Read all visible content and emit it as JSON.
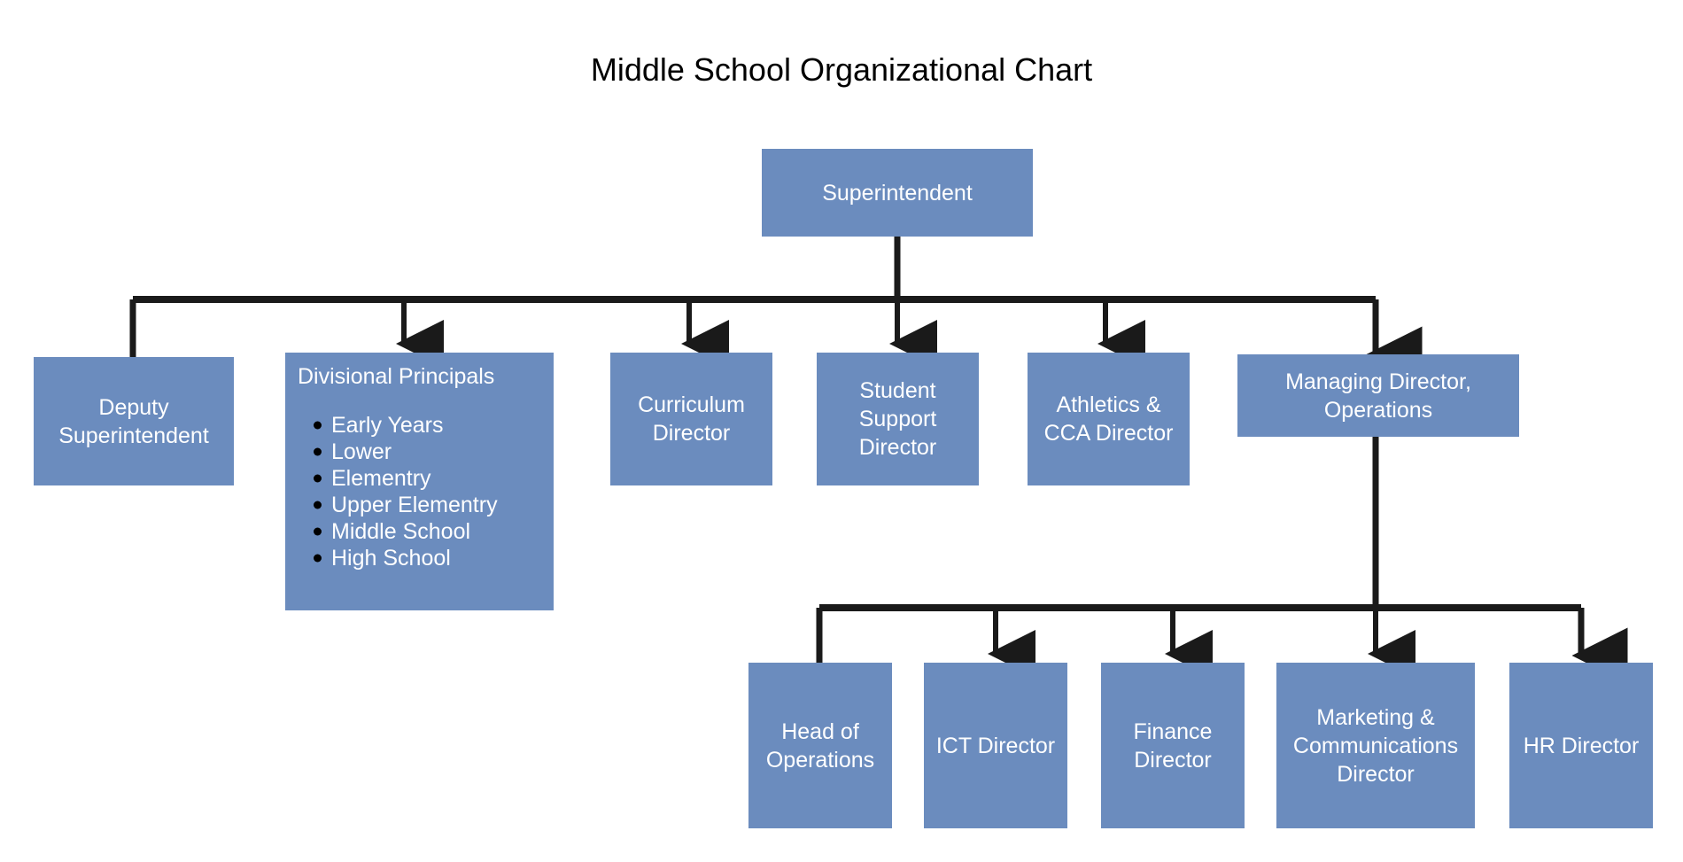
{
  "page": {
    "title": "Middle School Organizational Chart",
    "background_color": "#ffffff",
    "node_fill_color": "#6B8CBE",
    "node_text_color": "#ffffff",
    "connector_color": "#1A1A1A",
    "title_color": "#000000"
  },
  "nodes": {
    "superintendent": {
      "label": "Superintendent"
    },
    "deputy_superintendent": {
      "label": "Deputy\nSuperintendent"
    },
    "divisional_principals": {
      "heading": "Divisional Principals",
      "items": [
        "Early Years",
        "Lower",
        "Elementry",
        "Upper Elementry",
        "Middle School",
        "High School"
      ]
    },
    "curriculum_director": {
      "label": "Curriculum\nDirector"
    },
    "student_support_director": {
      "label": "Student\nSupport\nDirector"
    },
    "athletics_cca_director": {
      "label": "Athletics &\nCCA Director"
    },
    "managing_director_operations": {
      "label": "Managing Director,\nOperations"
    },
    "head_of_operations": {
      "label": "Head of\nOperations"
    },
    "ict_director": {
      "label": "ICT Director"
    },
    "finance_director": {
      "label": "Finance\nDirector"
    },
    "marketing_communications_director": {
      "label": "Marketing &\nCommunications\nDirector"
    },
    "hr_director": {
      "label": "HR Director"
    }
  },
  "chart_data": {
    "type": "diagram",
    "subtype": "organizational-chart",
    "title": "Middle School Organizational Chart",
    "root": "Superintendent",
    "levels": [
      [
        "Superintendent"
      ],
      [
        "Deputy Superintendent",
        "Divisional Principals",
        "Curriculum Director",
        "Student Support Director",
        "Athletics & CCA Director",
        "Managing Director, Operations"
      ],
      [
        "Head of Operations",
        "ICT Director",
        "Finance Director",
        "Marketing & Communications Director",
        "HR Director"
      ]
    ],
    "edges": [
      {
        "from": "Superintendent",
        "to": "Deputy Superintendent"
      },
      {
        "from": "Superintendent",
        "to": "Divisional Principals"
      },
      {
        "from": "Superintendent",
        "to": "Curriculum Director"
      },
      {
        "from": "Superintendent",
        "to": "Student Support Director"
      },
      {
        "from": "Superintendent",
        "to": "Athletics & CCA Director"
      },
      {
        "from": "Superintendent",
        "to": "Managing Director, Operations"
      },
      {
        "from": "Managing Director, Operations",
        "to": "Head of Operations"
      },
      {
        "from": "Managing Director, Operations",
        "to": "ICT Director"
      },
      {
        "from": "Managing Director, Operations",
        "to": "Finance Director"
      },
      {
        "from": "Managing Director, Operations",
        "to": "Marketing & Communications Director"
      },
      {
        "from": "Managing Director, Operations",
        "to": "HR Director"
      }
    ],
    "sublist": {
      "parent": "Divisional Principals",
      "items": [
        "Early Years",
        "Lower",
        "Elementry",
        "Upper Elementry",
        "Middle School",
        "High School"
      ]
    }
  }
}
